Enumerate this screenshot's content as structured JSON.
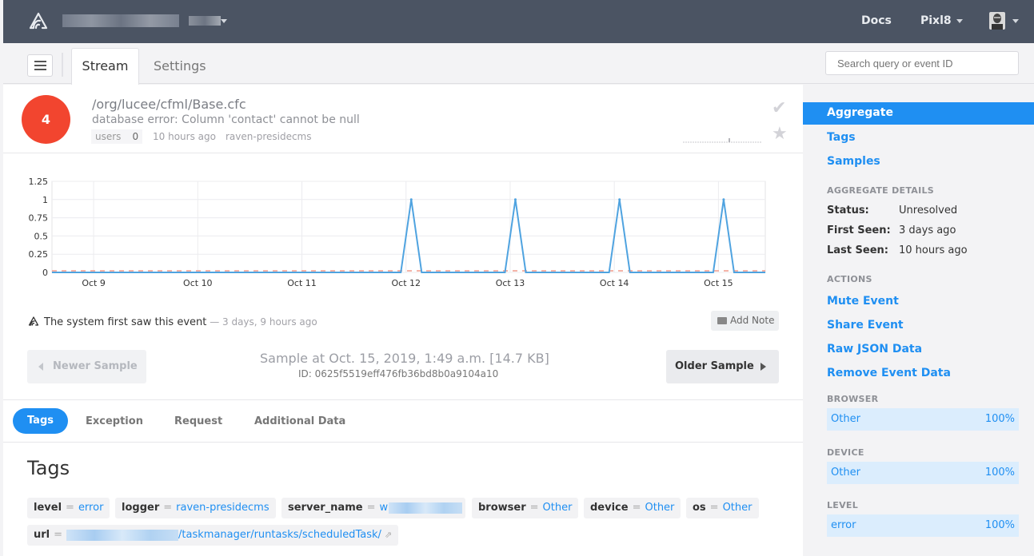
{
  "topbar": {
    "docs": "Docs",
    "org": "Pixl8"
  },
  "subheader": {
    "tab_stream": "Stream",
    "tab_settings": "Settings",
    "search_placeholder": "Search query or event ID"
  },
  "issue": {
    "count": "4",
    "title": "/org/lucee/cfml/Base.cfc",
    "message": "database error: Column 'contact' cannot be null",
    "users_label": "users",
    "users_count": "0",
    "last_seen": "10 hours ago",
    "logger": "raven-presidecms"
  },
  "chart_data": {
    "type": "line",
    "categories": [
      "Oct 9",
      "Oct 10",
      "Oct 11",
      "Oct 12",
      "Oct 13",
      "Oct 14",
      "Oct 15"
    ],
    "y_ticks": [
      "1.25",
      "1",
      "0.75",
      "0.5",
      "0.25",
      "0"
    ],
    "ylim": [
      0,
      1.25
    ],
    "series": [
      {
        "color": "#4fa3e0",
        "points": [
          [
            8.6,
            0
          ],
          [
            11.95,
            0
          ],
          [
            12.05,
            1
          ],
          [
            12.15,
            0
          ],
          [
            12.95,
            0
          ],
          [
            13.05,
            1
          ],
          [
            13.15,
            0
          ],
          [
            13.95,
            0
          ],
          [
            14.05,
            1
          ],
          [
            14.15,
            0
          ],
          [
            14.95,
            0
          ],
          [
            15.05,
            1
          ],
          [
            15.15,
            0
          ],
          [
            15.45,
            0
          ]
        ]
      }
    ],
    "xlim": [
      8.6,
      15.45
    ],
    "baseline_color": "#f29b8c",
    "grid": true
  },
  "activity": {
    "text": "The system first saw this event",
    "sep": " — ",
    "when": "3 days, 9 hours ago",
    "add_note": "Add Note"
  },
  "sample": {
    "newer": "Newer Sample",
    "older": "Older Sample",
    "title": "Sample at Oct. 15, 2019, 1:49 a.m. [14.7 KB]",
    "id": "ID: 0625f5519eff476fb36bd8b0a9104a10"
  },
  "event_tabs": [
    "Tags",
    "Exception",
    "Request",
    "Additional Data"
  ],
  "tags_heading": "Tags",
  "tags": [
    {
      "key": "level",
      "value": "error"
    },
    {
      "key": "logger",
      "value": "raven-presidecms"
    },
    {
      "key": "server_name",
      "value": "w"
    },
    {
      "key": "browser",
      "value": "Other"
    },
    {
      "key": "device",
      "value": "Other"
    },
    {
      "key": "os",
      "value": "Other"
    },
    {
      "key": "url",
      "value": "/taskmanager/runtasks/scheduledTask/"
    }
  ],
  "sidebar": {
    "nav": [
      "Aggregate",
      "Tags",
      "Samples"
    ],
    "details_heading": "AGGREGATE DETAILS",
    "status_label": "Status:",
    "status_value": "Unresolved",
    "first_seen_label": "First Seen:",
    "first_seen_value": "3 days ago",
    "last_seen_label": "Last Seen:",
    "last_seen_value": "10 hours ago",
    "actions_heading": "ACTIONS",
    "actions": [
      "Mute Event",
      "Share Event",
      "Raw JSON Data",
      "Remove Event Data"
    ],
    "browser_heading": "BROWSER",
    "browser_name": "Other",
    "browser_pct": "100%",
    "device_heading": "DEVICE",
    "device_name": "Other",
    "device_pct": "100%",
    "level_heading": "LEVEL",
    "level_name": "error",
    "level_pct": "100%"
  }
}
